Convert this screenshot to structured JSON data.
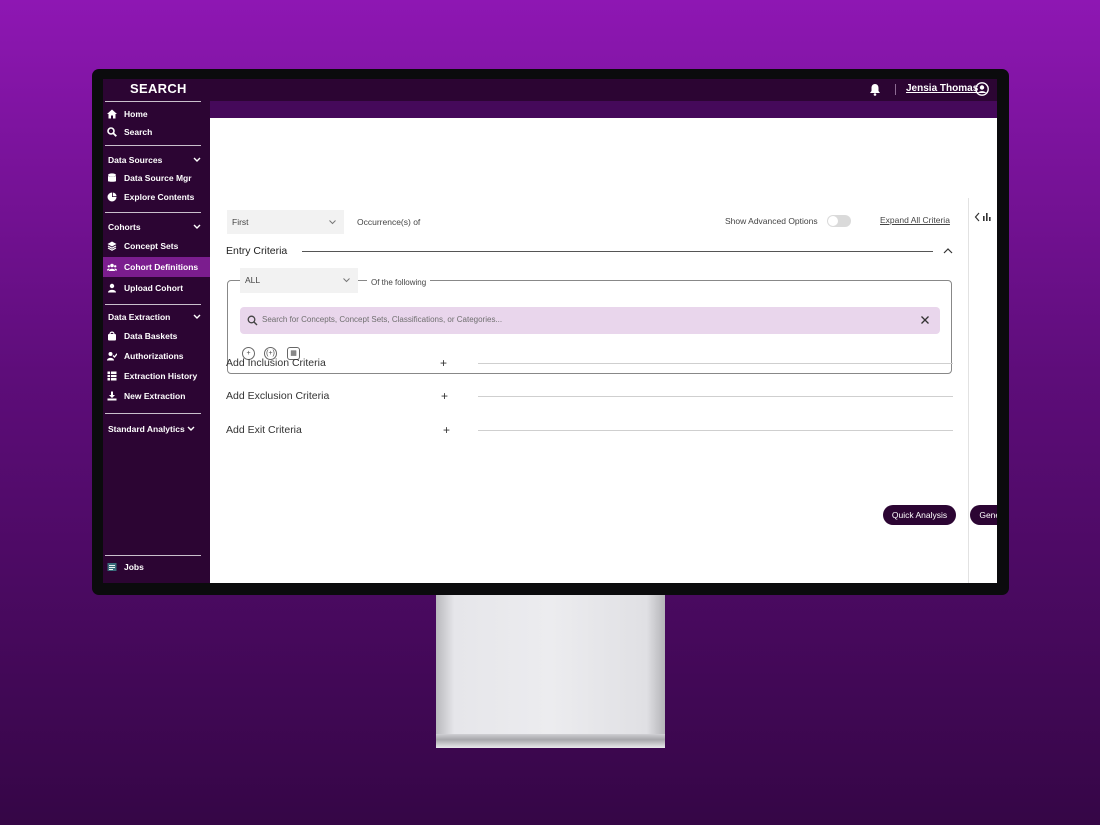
{
  "app": {
    "title": "SEARCH"
  },
  "user": {
    "name": "Jensia Thomas"
  },
  "sidebar": {
    "top_items": [
      {
        "label": "Home",
        "icon": "home-icon"
      },
      {
        "label": "Search",
        "icon": "search-icon"
      }
    ],
    "sections": [
      {
        "label": "Data Sources",
        "items": [
          {
            "label": "Data Source Mgr",
            "icon": "database-icon"
          },
          {
            "label": "Explore Contents",
            "icon": "pie-chart-icon"
          }
        ]
      },
      {
        "label": "Cohorts",
        "items": [
          {
            "label": "Concept Sets",
            "icon": "layers-icon"
          },
          {
            "label": "Cohort Definitions",
            "icon": "users-icon",
            "active": true
          },
          {
            "label": "Upload Cohort",
            "icon": "upload-user-icon"
          }
        ]
      },
      {
        "label": "Data Extraction",
        "items": [
          {
            "label": "Data Baskets",
            "icon": "basket-icon"
          },
          {
            "label": "Authorizations",
            "icon": "user-check-icon"
          },
          {
            "label": "Extraction History",
            "icon": "table-icon"
          },
          {
            "label": "New Extraction",
            "icon": "download-icon"
          }
        ]
      },
      {
        "label": "Standard Analytics",
        "items": []
      }
    ],
    "bottom_item": {
      "label": "Jobs",
      "icon": "jobs-icon"
    }
  },
  "controls": {
    "occurrence_select": "First",
    "occurrence_label": "Occurrence(s) of",
    "advanced_label": "Show Advanced Options",
    "advanced_enabled": false,
    "expand_all": "Expand All Criteria"
  },
  "entry": {
    "title": "Entry Criteria",
    "match_select": "ALL",
    "match_label": "Of the following",
    "search_placeholder": "Search for Concepts, Concept Sets, Classifications,  or Categories...",
    "tools": [
      "+",
      "(+)",
      "▦"
    ]
  },
  "criteria": {
    "inclusion": "Add Inclusion Criteria",
    "exclusion": "Add Exclusion Criteria",
    "exit": "Add Exit Criteria"
  },
  "actions": {
    "quick_analysis": "Quick Analysis",
    "generate_cohort": "Generate Cohort"
  },
  "colors": {
    "brand_dark": "#2c0533",
    "active_item": "#7b1d8e",
    "search_bg": "#e9d6ec"
  }
}
